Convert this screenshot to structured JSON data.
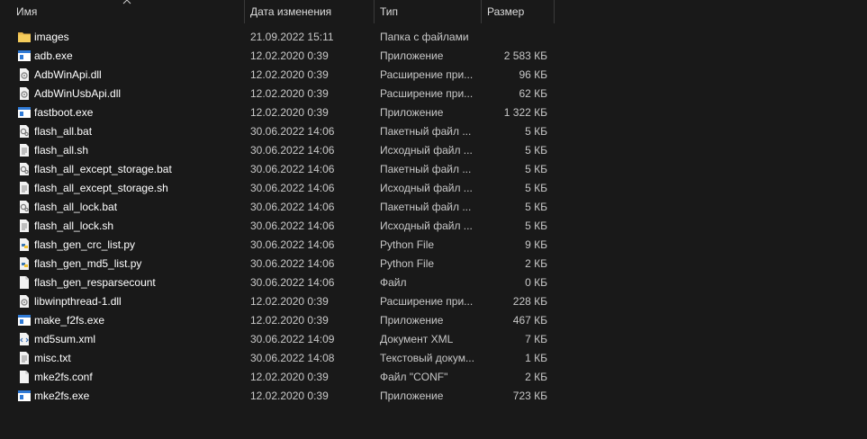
{
  "columns": {
    "name": "Имя",
    "date": "Дата изменения",
    "type": "Тип",
    "size": "Размер"
  },
  "files": [
    {
      "icon": "folder-icon",
      "name": "images",
      "date": "21.09.2022 15:11",
      "type": "Папка с файлами",
      "size": ""
    },
    {
      "icon": "exe-icon",
      "name": "adb.exe",
      "date": "12.02.2020 0:39",
      "type": "Приложение",
      "size": "2 583 КБ"
    },
    {
      "icon": "dll-icon",
      "name": "AdbWinApi.dll",
      "date": "12.02.2020 0:39",
      "type": "Расширение при...",
      "size": "96 КБ"
    },
    {
      "icon": "dll-icon",
      "name": "AdbWinUsbApi.dll",
      "date": "12.02.2020 0:39",
      "type": "Расширение при...",
      "size": "62 КБ"
    },
    {
      "icon": "exe-icon",
      "name": "fastboot.exe",
      "date": "12.02.2020 0:39",
      "type": "Приложение",
      "size": "1 322 КБ"
    },
    {
      "icon": "bat-icon",
      "name": "flash_all.bat",
      "date": "30.06.2022 14:06",
      "type": "Пакетный файл ...",
      "size": "5 КБ"
    },
    {
      "icon": "doc-icon",
      "name": "flash_all.sh",
      "date": "30.06.2022 14:06",
      "type": "Исходный файл ...",
      "size": "5 КБ"
    },
    {
      "icon": "bat-icon",
      "name": "flash_all_except_storage.bat",
      "date": "30.06.2022 14:06",
      "type": "Пакетный файл ...",
      "size": "5 КБ"
    },
    {
      "icon": "doc-icon",
      "name": "flash_all_except_storage.sh",
      "date": "30.06.2022 14:06",
      "type": "Исходный файл ...",
      "size": "5 КБ"
    },
    {
      "icon": "bat-icon",
      "name": "flash_all_lock.bat",
      "date": "30.06.2022 14:06",
      "type": "Пакетный файл ...",
      "size": "5 КБ"
    },
    {
      "icon": "doc-icon",
      "name": "flash_all_lock.sh",
      "date": "30.06.2022 14:06",
      "type": "Исходный файл ...",
      "size": "5 КБ"
    },
    {
      "icon": "python-icon",
      "name": "flash_gen_crc_list.py",
      "date": "30.06.2022 14:06",
      "type": "Python File",
      "size": "9 КБ"
    },
    {
      "icon": "python-icon",
      "name": "flash_gen_md5_list.py",
      "date": "30.06.2022 14:06",
      "type": "Python File",
      "size": "2 КБ"
    },
    {
      "icon": "blank-file-icon",
      "name": "flash_gen_resparsecount",
      "date": "30.06.2022 14:06",
      "type": "Файл",
      "size": "0 КБ"
    },
    {
      "icon": "dll-icon",
      "name": "libwinpthread-1.dll",
      "date": "12.02.2020 0:39",
      "type": "Расширение при...",
      "size": "228 КБ"
    },
    {
      "icon": "exe-icon",
      "name": "make_f2fs.exe",
      "date": "12.02.2020 0:39",
      "type": "Приложение",
      "size": "467 КБ"
    },
    {
      "icon": "xml-icon",
      "name": "md5sum.xml",
      "date": "30.06.2022 14:09",
      "type": "Документ XML",
      "size": "7 КБ"
    },
    {
      "icon": "doc-icon",
      "name": "misc.txt",
      "date": "30.06.2022 14:08",
      "type": "Текстовый докум...",
      "size": "1 КБ"
    },
    {
      "icon": "blank-file-icon",
      "name": "mke2fs.conf",
      "date": "12.02.2020 0:39",
      "type": "Файл \"CONF\"",
      "size": "2 КБ"
    },
    {
      "icon": "exe-icon",
      "name": "mke2fs.exe",
      "date": "12.02.2020 0:39",
      "type": "Приложение",
      "size": "723 КБ"
    }
  ]
}
